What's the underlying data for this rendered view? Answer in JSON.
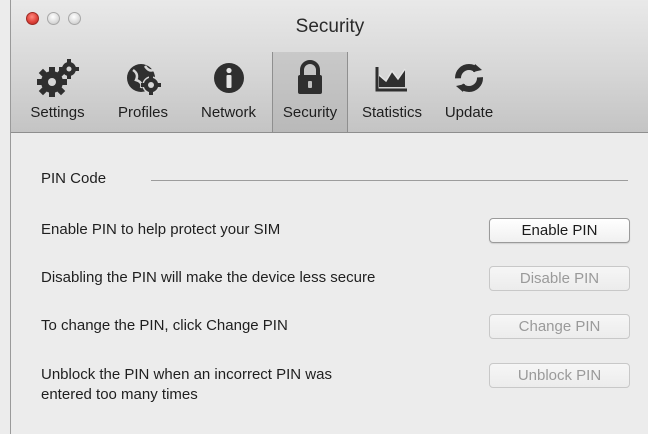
{
  "window": {
    "title": "Security"
  },
  "toolbar": {
    "tabs": [
      {
        "label": "Settings",
        "icon": "gears-icon",
        "active": false
      },
      {
        "label": "Profiles",
        "icon": "globe-gear-icon",
        "active": false
      },
      {
        "label": "Network",
        "icon": "info-icon",
        "active": false
      },
      {
        "label": "Security",
        "icon": "lock-icon",
        "active": true
      },
      {
        "label": "Statistics",
        "icon": "graph-icon",
        "active": false
      },
      {
        "label": "Update",
        "icon": "refresh-icon",
        "active": false
      }
    ]
  },
  "pin_section": {
    "title": "PIN Code",
    "rows": [
      {
        "text": "Enable PIN to help protect your SIM",
        "button": "Enable PIN",
        "enabled": true
      },
      {
        "text": "Disabling the PIN will make the device less secure",
        "button": "Disable PIN",
        "enabled": false
      },
      {
        "text": "To change the PIN, click Change PIN",
        "button": "Change PIN",
        "enabled": false
      },
      {
        "text_lines": [
          "Unblock the PIN when an incorrect PIN was",
          "entered too many times"
        ],
        "button": "Unblock PIN",
        "enabled": false
      }
    ]
  },
  "colors": {
    "close_light": "#e0443c",
    "active_tab": "#bdbdbd",
    "disabled_text": "#9a9a9a"
  }
}
